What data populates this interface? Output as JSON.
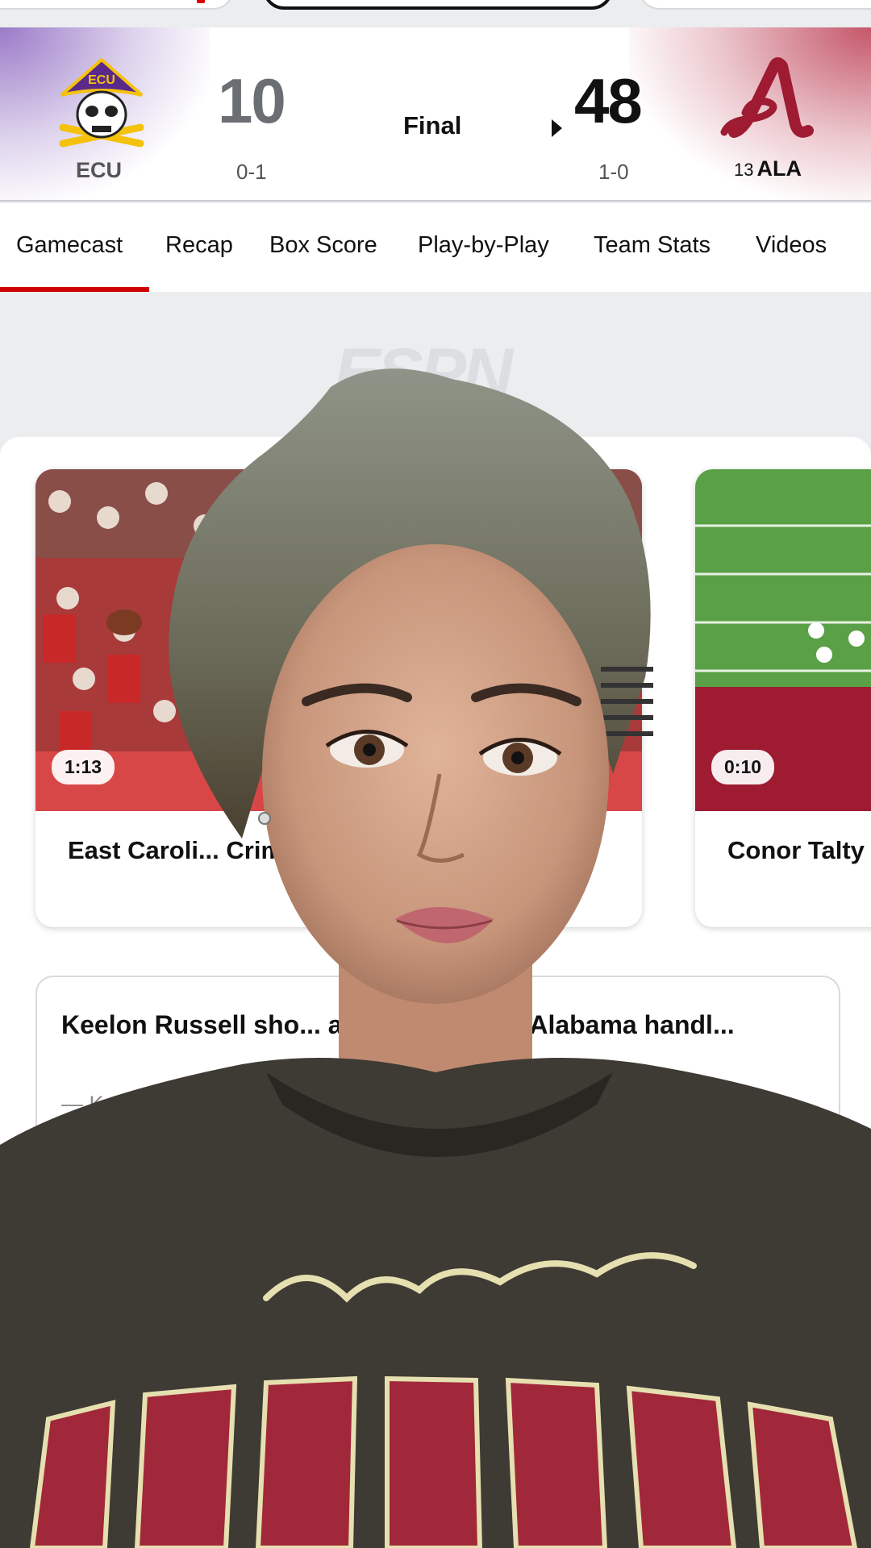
{
  "scoreboard": {
    "away": {
      "abbr": "ECU",
      "score": "10",
      "record": "0-1",
      "logo_icon": "ecu-pirate-logo-icon",
      "color": "#592a8a"
    },
    "home": {
      "abbr": "ALA",
      "rank": "13",
      "score": "48",
      "record": "1-0",
      "logo_icon": "alabama-script-a-logo-icon",
      "color": "#9e1b32"
    },
    "status": "Final",
    "winner_indicator_icon": "triangle-right-icon"
  },
  "tabs": [
    {
      "label": "Gamecast",
      "active": true
    },
    {
      "label": "Recap"
    },
    {
      "label": "Box Score"
    },
    {
      "label": "Play-by-Play"
    },
    {
      "label": "Team Stats"
    },
    {
      "label": "Videos"
    }
  ],
  "accent_color": "#d00000",
  "watermark": "ESPN",
  "videos": [
    {
      "duration": "1:13",
      "title": "East Caroli... Crimson Tide: Ga..."
    },
    {
      "duration": "0:10",
      "title": "Conor Talty"
    }
  ],
  "article": {
    "title": "Keelon Russell sho... ability as No. 13 Alabama handl...",
    "byline": "— Keelon R..."
  }
}
